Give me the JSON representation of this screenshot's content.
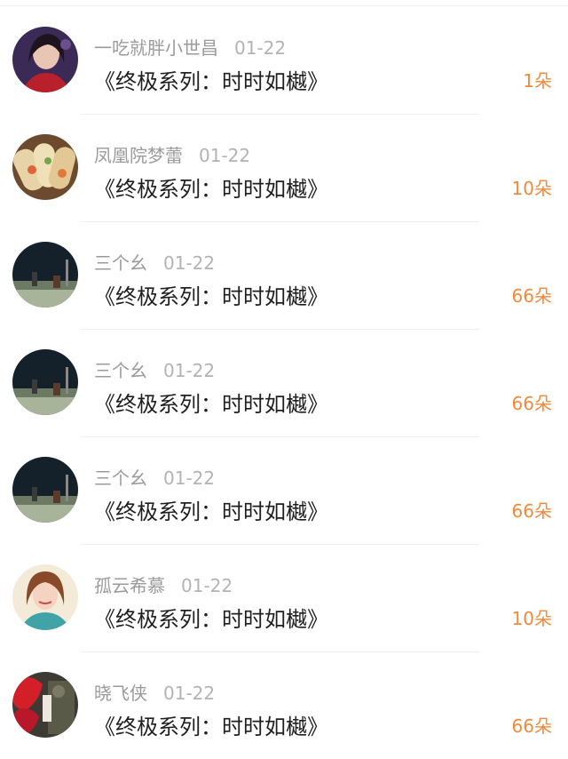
{
  "items": [
    {
      "user": "一吃就胖小世昌",
      "date": "01-22",
      "title": "《终极系列：时时如樾》",
      "gift": "1朵",
      "avatar": "woman-in-red-avatar"
    },
    {
      "user": "凤凰院梦蕾",
      "date": "01-22",
      "title": "《终极系列：时时如樾》",
      "gift": "10朵",
      "avatar": "food-rolls-avatar"
    },
    {
      "user": "三个幺",
      "date": "01-22",
      "title": "《终极系列：时时如樾》",
      "gift": "66朵",
      "avatar": "dark-landscape-avatar"
    },
    {
      "user": "三个幺",
      "date": "01-22",
      "title": "《终极系列：时时如樾》",
      "gift": "66朵",
      "avatar": "dark-landscape-avatar"
    },
    {
      "user": "三个幺",
      "date": "01-22",
      "title": "《终极系列：时时如樾》",
      "gift": "66朵",
      "avatar": "dark-landscape-avatar"
    },
    {
      "user": "孤云希慕",
      "date": "01-22",
      "title": "《终极系列：时时如樾》",
      "gift": "10朵",
      "avatar": "smiling-girl-avatar"
    },
    {
      "user": "晓飞侠",
      "date": "01-22",
      "title": "《终极系列：时时如樾》",
      "gift": "66朵",
      "avatar": "red-flowers-avatar"
    }
  ],
  "colors": {
    "gift": "#f08a3c",
    "meta": "#9b9b9b",
    "title": "#1f1f1f"
  }
}
